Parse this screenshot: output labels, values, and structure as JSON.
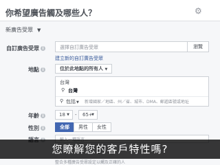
{
  "header": {
    "title": "你希望廣告觸及哪些人？",
    "settings_icon": "gear-icon"
  },
  "selector": {
    "label": "新廣告受眾",
    "caret_icon": "caret-down-icon"
  },
  "custom_audience": {
    "label": "自訂廣告受眾",
    "placeholder": "選擇自訂廣告受眾",
    "browse_label": "瀏覽",
    "create_link": "建立新的自訂廣告受眾"
  },
  "location": {
    "label": "地點",
    "mode_label": "位於此地點的所有人",
    "country_header": "台灣",
    "selected_place": "台灣",
    "include_label": "包括",
    "placeholder": "新增國家／地區、州／省、城市、DMA、郵遞區號或地址"
  },
  "age": {
    "label": "年齡",
    "min": "18",
    "max": "65+",
    "separator": "-"
  },
  "gender": {
    "label": "性別",
    "options": [
      "全部",
      "男性",
      "女性"
    ],
    "selected": "全部"
  },
  "language": {
    "label": "語言",
    "placeholder": "輸入一種語言..."
  },
  "caption": "您瞭解您的客戶特性嗎?",
  "footer_text": "整合多種廣告受眾設定以觸及正確的人"
}
